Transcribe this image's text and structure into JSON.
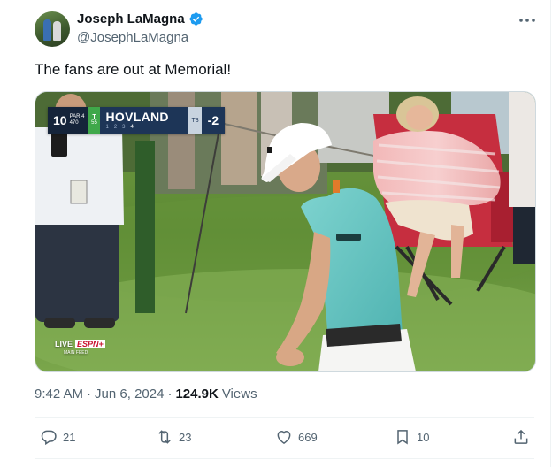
{
  "author": {
    "display_name": "Joseph LaMagna",
    "handle": "@JosephLaMagna",
    "verified_icon": "verified-badge-icon",
    "avatar_icon": "avatar"
  },
  "tweet": {
    "text": "The fans are out at Memorial!",
    "time": "9:42 AM",
    "separator": "·",
    "date": "Jun 6, 2024",
    "views_count": "124.9K",
    "views_label": "Views"
  },
  "scorebug": {
    "hole": "10",
    "par_label": "PAR 4",
    "yards": "470",
    "tee_label": "T",
    "tee_sub": "55",
    "player": "HOVLAND",
    "position": "T3",
    "score": "-2",
    "round_numbers": [
      "1",
      "2",
      "3",
      "4"
    ]
  },
  "broadcast": {
    "live_label": "LIVE",
    "network": "ESPN+",
    "feed": "MAIN FEED"
  },
  "actions": {
    "reply_count": "21",
    "retweet_count": "23",
    "like_count": "669",
    "bookmark_count": "10"
  },
  "colors": {
    "accent": "#1d9bf0",
    "muted_text": "#536471",
    "primary_text": "#0f1419"
  }
}
